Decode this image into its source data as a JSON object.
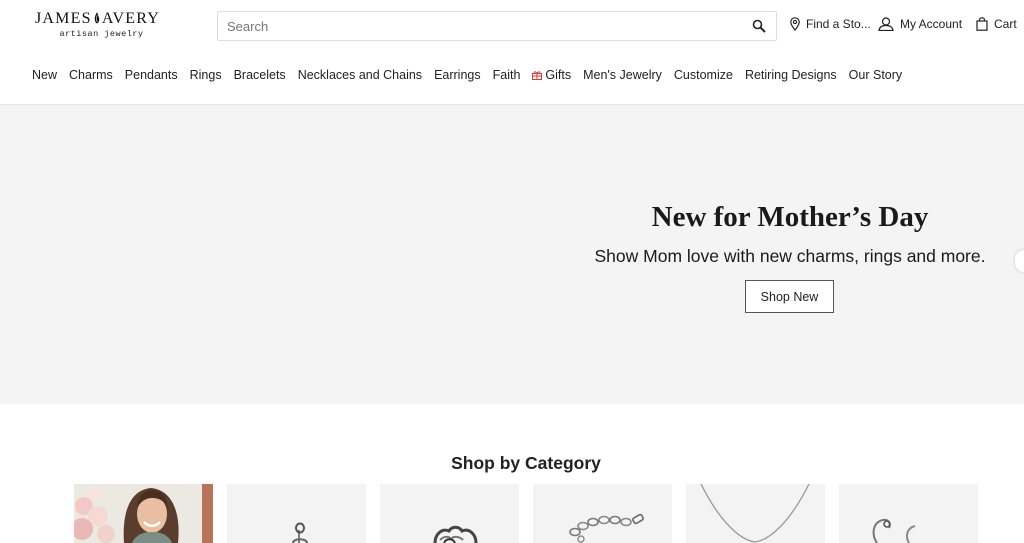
{
  "brand": {
    "name_left": "JAMES",
    "name_right": "AVERY",
    "tagline": "artisan jewelry"
  },
  "search": {
    "placeholder": "Search",
    "value": ""
  },
  "utility": {
    "store": "Find a Sto...",
    "account": "My Account",
    "cart": "Cart"
  },
  "nav": {
    "items": [
      {
        "label": "New"
      },
      {
        "label": "Charms"
      },
      {
        "label": "Pendants"
      },
      {
        "label": "Rings"
      },
      {
        "label": "Bracelets"
      },
      {
        "label": "Necklaces and Chains"
      },
      {
        "label": "Earrings"
      },
      {
        "label": "Faith"
      },
      {
        "label": "Gifts",
        "icon": "gift-icon"
      },
      {
        "label": "Men's Jewelry"
      },
      {
        "label": "Customize"
      },
      {
        "label": "Retiring Designs"
      },
      {
        "label": "Our Story"
      }
    ]
  },
  "hero": {
    "title": "New for Mother’s Day",
    "subtitle": "Show Mom love with new charms, rings and more.",
    "button": "Shop New"
  },
  "category": {
    "title": "Shop by Category",
    "tiles": [
      {
        "icon": "woman-photo"
      },
      {
        "icon": "charm-icon"
      },
      {
        "icon": "ring-icon"
      },
      {
        "icon": "bracelet-icon"
      },
      {
        "icon": "necklace-icon"
      },
      {
        "icon": "earring-icon"
      }
    ]
  },
  "colors": {
    "hero_bg": "#f4f4f4",
    "tile_bg": "#f3f3f3",
    "gift_accent": "#d23b3b",
    "text": "#222222"
  }
}
